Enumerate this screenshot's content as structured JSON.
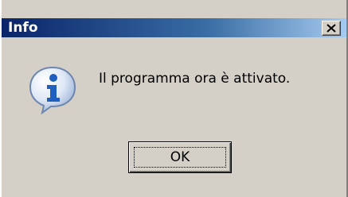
{
  "window": {
    "title": "Info"
  },
  "titlebar": {
    "close_icon": "close-icon"
  },
  "dialog": {
    "icon": "info-icon",
    "message": "Il programma ora è attivato.",
    "ok_label": "OK"
  },
  "colors": {
    "titlebar_start": "#0a246a",
    "titlebar_end": "#a6caf0",
    "face": "#d4d0c8",
    "icon_blue": "#1f5fbf"
  }
}
